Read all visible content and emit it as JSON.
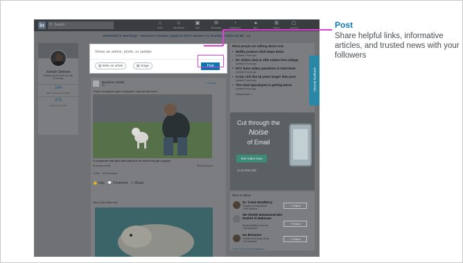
{
  "annotation": {
    "title": "Post",
    "body": "Share helpful links, informative articles, and trusted news with your followers"
  },
  "topbar": {
    "logo_text": "in",
    "search_placeholder": "Search",
    "nav": [
      {
        "label": "Home",
        "icon": "home-icon",
        "glyph": "⌂"
      },
      {
        "label": "My Network",
        "icon": "network-icon",
        "glyph": "☺"
      },
      {
        "label": "Jobs",
        "icon": "briefcase-icon",
        "glyph": "▣"
      },
      {
        "label": "Messaging",
        "icon": "messaging-icon",
        "glyph": "✉"
      },
      {
        "label": "Notifications",
        "icon": "bell-icon",
        "glyph": "◔"
      },
      {
        "label": "Me ▾",
        "icon": "avatar-icon",
        "glyph": "●"
      },
      {
        "label": "Work ▾",
        "icon": "grid-icon",
        "glyph": "⊞"
      },
      {
        "label": "Learning",
        "icon": "learning-icon",
        "glyph": "▢"
      }
    ]
  },
  "promo": {
    "text": "Interested in Teaching? – Become a Teacher. Apply to USC's Master's in Teaching Online by 6/1",
    "suffix": "· Ad"
  },
  "profile": {
    "name": "Joseph Setoson",
    "description": "Bridging opportunities through knowledge",
    "stats": [
      {
        "value": "164",
        "label": "Who's viewed your profile"
      },
      {
        "value": "475",
        "label": "Views of your post"
      }
    ]
  },
  "share_box": {
    "placeholder": "Share an article, photo, or update",
    "write_article": "Write an article",
    "image": "Image",
    "post": "Post"
  },
  "feed": [
    {
      "source": "Business Insider",
      "sub": "2h",
      "follow": "+ Follow",
      "caption": "These companies give employees 'paw-ternity leave'",
      "title": "5 companies that give staff paid time off when they get a puppy",
      "meta_left": "Business Insider",
      "meta_right": "Working Hours",
      "likes": "To like · 13 Comments",
      "actions": [
        "Like",
        "Comment",
        "Share"
      ]
    },
    {
      "header": "Tony Chen likes this"
    }
  ],
  "news": {
    "header": "What people are talking about now",
    "items": [
      {
        "title": "Netflix product chief steps down",
        "time": "Updated 2 hours ago"
      },
      {
        "title": "NY strikes deal to offer tuition-free college",
        "time": "Updated 3 hours ago"
      },
      {
        "title": "NYC bans salary questions in interviews",
        "time": "Updated 3 hours ago"
      },
      {
        "title": "In US, rich live 15 years longer than poor",
        "time": "Updated 5 hours ago"
      },
      {
        "title": "The retail apocalypse is getting worse",
        "time": "Updated 6 hours ago"
      }
    ],
    "show_more": "Show more"
  },
  "ad": {
    "line1": "Cut through the",
    "line2": "Noise",
    "line3": "of Email",
    "cta": "See Video Now",
    "brand": "CLEARSLIDE"
  },
  "who_to_follow": {
    "header": "Who to follow",
    "people": [
      {
        "name": "Dr. Travis Bradberry",
        "desc": "President at TalentSmart",
        "desc2": "1,996 followers",
        "follow": "+ Follow"
      },
      {
        "name": "HH Sheikh Mohammed Bin Rashid Al Maktoum",
        "desc": "We are building a new era",
        "desc2": "1,1M followers",
        "follow": "+ Follow"
      },
      {
        "name": "Ian Bremmer",
        "desc": "President at Eurasia Group",
        "desc2": "1,1M followers",
        "follow": "+ Follow"
      }
    ],
    "view_all": "View all recommendations"
  },
  "feedback_tab": "Internal feedback"
}
